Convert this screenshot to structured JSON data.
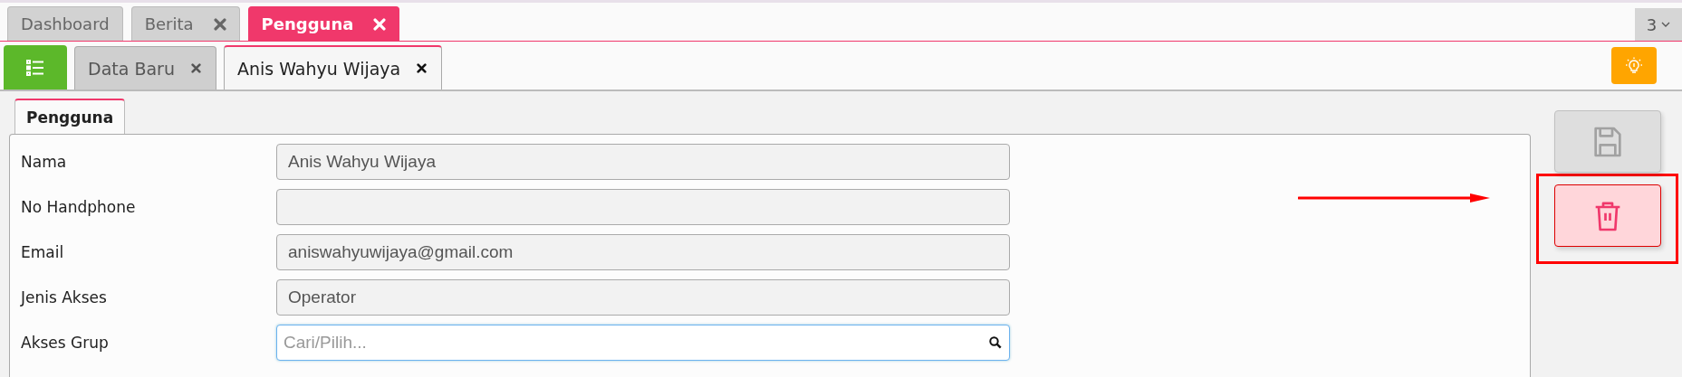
{
  "main_tabs": [
    {
      "label": "Dashboard",
      "selected": false,
      "closable": false
    },
    {
      "label": "Berita",
      "selected": false,
      "closable": true
    },
    {
      "label": "Pengguna",
      "selected": true,
      "closable": true
    }
  ],
  "tab_count": "3",
  "sub_tabs": [
    {
      "label": "Data Baru",
      "selected": false
    },
    {
      "label": "Anis Wahyu Wijaya",
      "selected": true
    }
  ],
  "section_tab": {
    "label": "Pengguna",
    "selected": true
  },
  "form": [
    {
      "label": "Nama",
      "kind": "readonly",
      "value": "Anis Wahyu Wijaya"
    },
    {
      "label": "No Handphone",
      "kind": "readonly"
    },
    {
      "label": "Email",
      "kind": "readonly",
      "value": "aniswahyuwijaya@gmail.com"
    },
    {
      "label": "Jenis Akses",
      "kind": "readonly",
      "value": "Operator"
    },
    {
      "label": "Akses Grup",
      "kind": "search",
      "placeholder": "Cari/Pilih..."
    }
  ],
  "actions": [
    {
      "kind": "save",
      "disabled": true
    },
    {
      "kind": "delete",
      "disabled": false
    }
  ]
}
